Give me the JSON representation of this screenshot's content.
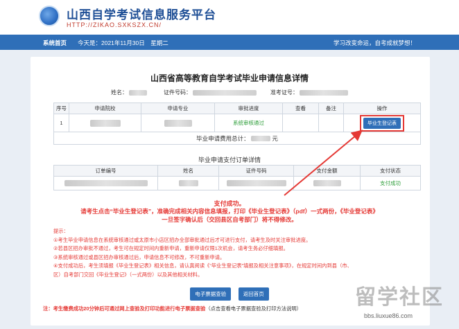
{
  "header": {
    "title": "山西自学考试信息服务平台",
    "url": "HTTP://ZIKAO.SXKSZX.CN/"
  },
  "nav": {
    "home": "系统首页",
    "date": "今天是：2021年11月30日　星期二",
    "slogan": "学习改变命运，自考成就梦想！"
  },
  "page": {
    "title": "山西省高等教育自学考试毕业申请信息详情",
    "name_label": "姓名：",
    "id_label": "证件号码：",
    "ticket_label": "准考证号："
  },
  "app_table": {
    "headers": [
      "序号",
      "申请院校",
      "申请专业",
      "审批进度",
      "查看",
      "备注",
      "操作"
    ],
    "row": {
      "index": "1",
      "progress": "系统审核通过",
      "action": "毕业生登记表"
    },
    "fee_label": "毕业申请费用总计：",
    "fee_unit": "元"
  },
  "order_table": {
    "title": "毕业申请支付订单详情",
    "headers": [
      "订单编号",
      "姓名",
      "证件号码",
      "支付金额",
      "支付状态"
    ],
    "status": "支付成功"
  },
  "messages": {
    "success": "支付成功。",
    "line1": "请考生点击“毕业生登记表”，准确完成相关内容信息填报，打印《毕业生登记表》（pdf）一式两份，《毕业登记表》",
    "line2": "一旦签字确认后（交回县区自考部门）将不得修改。"
  },
  "tips": {
    "heading": "提示：",
    "t1": "①考生毕业申请信息在系统审核通过或太原市小店区招办全部审批通过后才可进行支付，请考生及时关注审批进度。",
    "t2": "②若县区招办审批不通过，考生可在规定时间内重新申请，重新申请仅限1次机会，请考生务必仔细填报。",
    "t3": "③系统审核通过或县区招办审核通过后，申请信息不可修改，不可重新申请。",
    "t4": "④支付成功后，考生须填报《毕业生登记表》相关信息，请认真阅读《“毕业生登记表”填报及相关注意事项》，在规定时间内到县（市、",
    "t5": "区）自考部门交回《毕业生登记》（一式两份）以及其他相关材料。"
  },
  "buttons": {
    "invoice": "电子票据查验",
    "back": "返回首页"
  },
  "note": {
    "main": "注：考生缴费成功20分钟后可通过网上查验及打印功能进行电子票据查验",
    "link": "（点击查看电子票据查验及打印方法说明）"
  },
  "watermark": {
    "text": "留学社区",
    "sub": "bbs.liuxue86.com"
  },
  "colors": {
    "nav": "#2f6fb8",
    "alert": "#e53935",
    "success": "#2e9e3a"
  }
}
